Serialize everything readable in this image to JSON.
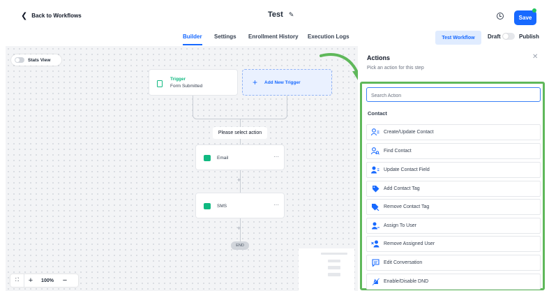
{
  "header": {
    "back_label": "Back to Workflows",
    "title": "Test",
    "save_label": "Save"
  },
  "tabs": [
    {
      "label": "Builder",
      "active": true
    },
    {
      "label": "Settings",
      "active": false
    },
    {
      "label": "Enrollment History",
      "active": false
    },
    {
      "label": "Execution Logs",
      "active": false
    }
  ],
  "toolbar": {
    "test_workflow_label": "Test Workflow",
    "draft_label": "Draft",
    "publish_label": "Publish"
  },
  "canvas": {
    "stats_view_label": "Stats View",
    "trigger": {
      "title": "Trigger",
      "subtitle": "Form Submitted"
    },
    "add_trigger_label": "Add New Trigger",
    "select_action_label": "Please select action",
    "actions": [
      {
        "label": "Email",
        "icon": "email-icon"
      },
      {
        "label": "SMS",
        "icon": "sms-icon"
      }
    ],
    "end_label": "END",
    "zoom": "100%"
  },
  "panel": {
    "title": "Actions",
    "subtitle": "Pick an action for this step",
    "search_placeholder": "Search Action",
    "category": "Contact",
    "items": [
      {
        "label": "Create/Update Contact",
        "icon": "user-list-icon"
      },
      {
        "label": "Find Contact",
        "icon": "user-search-icon"
      },
      {
        "label": "Update Contact Field",
        "icon": "user-edit-icon"
      },
      {
        "label": "Add Contact Tag",
        "icon": "tag-icon"
      },
      {
        "label": "Remove Contact Tag",
        "icon": "tag-remove-icon"
      },
      {
        "label": "Assign To User",
        "icon": "user-assign-icon"
      },
      {
        "label": "Remove Assigned User",
        "icon": "user-remove-icon"
      },
      {
        "label": "Edit Conversation",
        "icon": "chat-edit-icon"
      },
      {
        "label": "Enable/Disable DND",
        "icon": "dnd-icon"
      }
    ]
  },
  "colors": {
    "accent": "#1769ff",
    "success": "#10b981",
    "highlight": "#5fb85a"
  }
}
